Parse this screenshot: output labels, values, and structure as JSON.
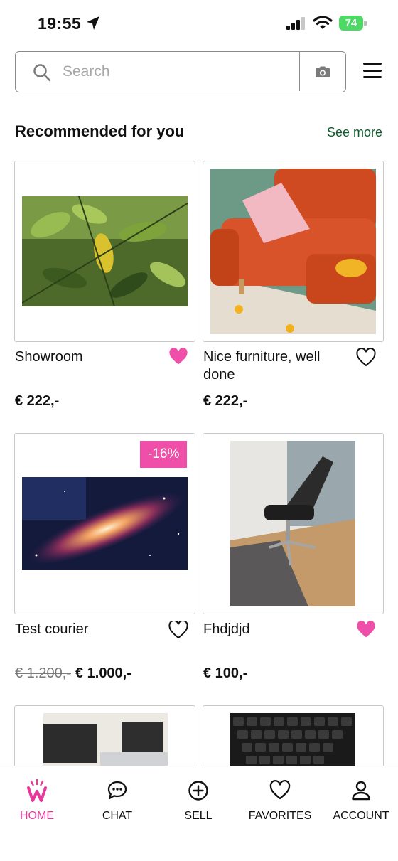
{
  "status_bar": {
    "time": "19:55",
    "battery": "74"
  },
  "search": {
    "placeholder": "Search"
  },
  "section": {
    "title": "Recommended for you",
    "see_more": "See more"
  },
  "products": [
    {
      "title": "Showroom",
      "price": "€ 222,-",
      "favorite": true,
      "image": "plant-leaves"
    },
    {
      "title": "Nice furniture, well done",
      "price": "€ 222,-",
      "favorite": false,
      "image": "orange-sofa"
    },
    {
      "title": "Test courier",
      "old_price": "€ 1.200,-",
      "price": "€ 1.000,-",
      "badge": "-16%",
      "favorite": false,
      "image": "galaxy"
    },
    {
      "title": "Fhdjdjd",
      "price": "€ 100,-",
      "favorite": true,
      "image": "office-chair"
    },
    {
      "title": "",
      "price": "",
      "favorite": false,
      "image": "office-monitors"
    },
    {
      "title": "",
      "price": "",
      "favorite": false,
      "image": "keyboard"
    }
  ],
  "nav": {
    "items": [
      {
        "label": "HOME",
        "icon": "home-logo-icon",
        "active": true
      },
      {
        "label": "CHAT",
        "icon": "chat-icon",
        "active": false
      },
      {
        "label": "SELL",
        "icon": "plus-circle-icon",
        "active": false
      },
      {
        "label": "FAVORITES",
        "icon": "heart-icon",
        "active": false
      },
      {
        "label": "ACCOUNT",
        "icon": "person-icon",
        "active": false
      }
    ]
  },
  "colors": {
    "accent": "#e8389a",
    "badge": "#f04fa9",
    "see_more": "#0f5a2c",
    "battery": "#4cd964"
  }
}
